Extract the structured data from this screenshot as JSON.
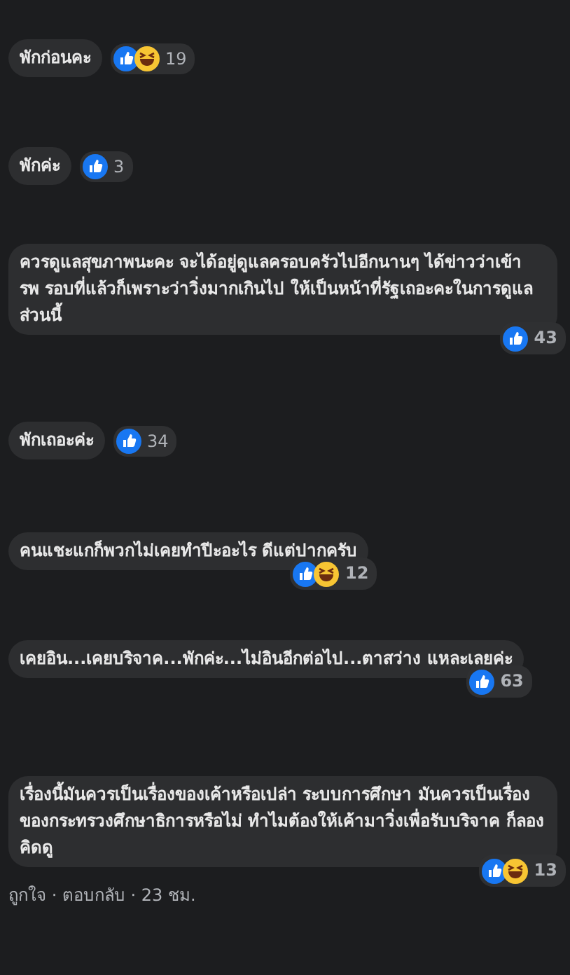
{
  "comments": [
    {
      "kind": "short",
      "text": "พักก่อนคะ",
      "reactions": [
        {
          "kind": "like"
        },
        {
          "kind": "haha"
        }
      ],
      "count": "19"
    },
    {
      "kind": "short",
      "text": "พักค่ะ",
      "reactions": [
        {
          "kind": "like"
        }
      ],
      "count": "3"
    },
    {
      "kind": "long",
      "text": "ควรดูแลสุขภาพนะคะ จะได้อยู่ดูแลครอบครัวไปอีกนานๆ ได้ข่าวว่าเข้า รพ รอบที่แล้วก็เพราะว่าวิ่งมากเกินไป ให้เป็นหน้าที่รัฐเถอะคะในการดูแลส่วนนี้",
      "reactions": [
        {
          "kind": "like"
        }
      ],
      "count": "43"
    },
    {
      "kind": "short",
      "text": "พักเถอะค่ะ",
      "reactions": [
        {
          "kind": "like"
        }
      ],
      "count": "34"
    },
    {
      "kind": "long",
      "text": "คนแชะแกก็พวกไม่เคยทำปีะอะไร ดีแต่ปากครับ",
      "reactions": [
        {
          "kind": "like"
        },
        {
          "kind": "haha"
        }
      ],
      "count": "12"
    },
    {
      "kind": "long",
      "text": "เคยอิน...เคยบริจาค...พักค่ะ...ไม่อินอีกต่อไป...ตาสว่าง แหละเลยค่ะ",
      "reactions": [
        {
          "kind": "like"
        }
      ],
      "count": "63"
    },
    {
      "kind": "long",
      "text": "เรื่องนี้มันควรเป็นเรื่องของเค้าหรือเปล่า ระบบการศึกษา มันควรเป็นเรื่องของกระทรวงศึกษาธิการหรือไม่ ทำไมต้องให้เค้ามาวิ่งเพื่อรับบริจาค ก็ลองคิดดู",
      "reactions": [
        {
          "kind": "like"
        },
        {
          "kind": "haha"
        }
      ],
      "count": "13",
      "footer": "ถูกใจ · ตอบกลับ · 23 ชม."
    }
  ]
}
